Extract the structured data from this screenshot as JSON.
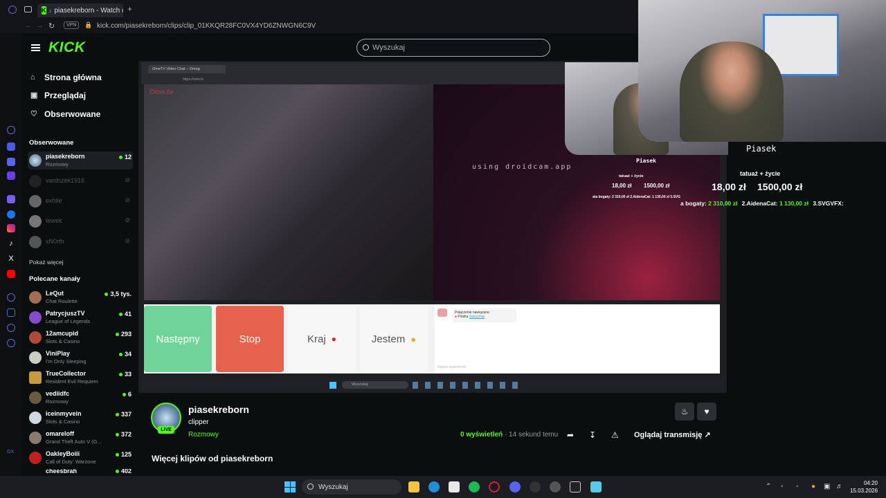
{
  "browser": {
    "tab_title": "piasekreborn - Watch c",
    "url": "kick.com/piasekreborn/clips/clip_01KKQR28FC0VX4YD6ZNWGN6C9V",
    "vpn_label": "VPN"
  },
  "header": {
    "logo": "KICK",
    "search_placeholder": "Wyszukaj"
  },
  "sidebar": {
    "nav": [
      {
        "label": "Strona główna",
        "icon": "home-icon"
      },
      {
        "label": "Przeglądaj",
        "icon": "browse-icon"
      },
      {
        "label": "Obserwowane",
        "icon": "heart-icon"
      }
    ],
    "followed_title": "Obserwowane",
    "followed": [
      {
        "name": "piasekreborn",
        "category": "Rozmowy",
        "viewers": "12",
        "live": true
      },
      {
        "name": "vardszek1916",
        "live": false
      },
      {
        "name": "exhile",
        "live": false
      },
      {
        "name": "tewek",
        "live": false
      },
      {
        "name": "xN0rth",
        "live": false
      }
    ],
    "show_more": "Pokaż więcej",
    "recommended_title": "Polecane kanały",
    "recommended": [
      {
        "name": "LeQut",
        "category": "Chat Roulette",
        "viewers": "3,5 tys."
      },
      {
        "name": "PatrycjuszTV",
        "category": "League of Legends",
        "viewers": "41"
      },
      {
        "name": "12amcupid",
        "category": "Slots & Casino",
        "viewers": "293"
      },
      {
        "name": "ViniPlay",
        "category": "I'm Only Sleeping",
        "viewers": "34"
      },
      {
        "name": "TrueCollector",
        "category": "Resident Evil Requiem",
        "viewers": "33"
      },
      {
        "name": "vediidfc",
        "category": "Rozmowy",
        "viewers": "6"
      },
      {
        "name": "iceinmyvein",
        "category": "Slots & Casino",
        "viewers": "337"
      },
      {
        "name": "omareloff",
        "category": "Grand Theft Auto V (G...",
        "viewers": "372"
      },
      {
        "name": "OakleyBoiii",
        "category": "Call of Duty: Warzone",
        "viewers": "125"
      },
      {
        "name": "cheesbrah",
        "category": "",
        "viewers": "402"
      }
    ]
  },
  "video": {
    "inner_tab": "OmeTV Video Chat – Omeg",
    "inner_url": "https://ome.tv",
    "ometv_logo": "Ome.tv",
    "droidcam_text": "using droidcam.app",
    "overlay_small": {
      "name": "Piasek",
      "goal": "tatuaż + życie",
      "amount1": "18,00 zł",
      "amount2": "1500,00 zł",
      "leader_text": "ata bogaty: 2 310,00 zł  2.AidenaCat: 1 130,00 zł  3.SVG"
    },
    "buttons": {
      "next": "Następny",
      "stop": "Stop",
      "country": "Kraj",
      "iam": "Jestem"
    },
    "chat_msg": "Połączenie nawiązane.",
    "chat_country": "Polska",
    "chat_link": "Zatrzymaj",
    "chat_placeholder": "Napisz wiadomość",
    "inner_search": "Wyszukaj"
  },
  "overlay": {
    "name": "Piasek",
    "goal": "tatuaż + życie",
    "amount1": "18,00 zł",
    "amount2": "1500,00 zł",
    "leader1_prefix": "a bogaty:",
    "leader1_value": "2 310,00 zł",
    "leader2_prefix": "2.AidenaCat:",
    "leader2_value": "1 130,00 zł",
    "leader3": "3.SVGVFX:"
  },
  "clip": {
    "channel": "piasekreborn",
    "clipper": "clipper",
    "category": "Rozmowy",
    "live_badge": "LIVE",
    "views_count": "0",
    "views_label": "wyświetleń",
    "time": "· 14 sekund temu",
    "watch_label": "Oglądaj transmisję",
    "more_clips": "Więcej klipów od piasekreborn"
  },
  "taskbar": {
    "search": "Wyszukaj",
    "time": "04:20",
    "date": "15.03.2026"
  },
  "colors": {
    "accent": "#53fc18",
    "next_button": "#6fd39a",
    "stop_button": "#e5634c"
  }
}
